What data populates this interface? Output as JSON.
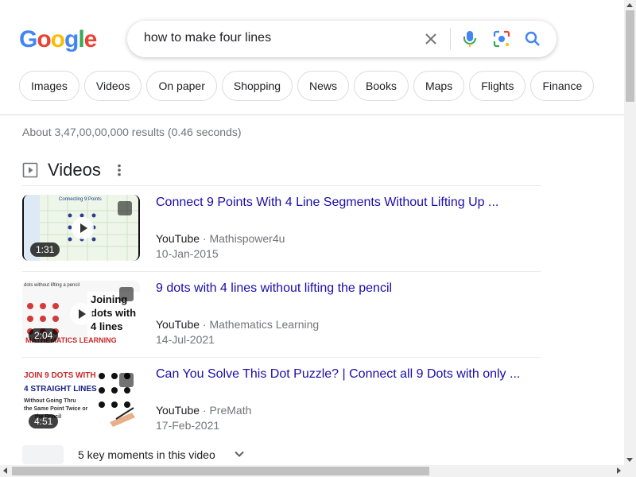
{
  "logo": {
    "letters": [
      "G",
      "o",
      "o",
      "g",
      "l",
      "e"
    ],
    "colors": [
      "#4285F4",
      "#EA4335",
      "#FBBC05",
      "#4285F4",
      "#34A853",
      "#EA4335"
    ]
  },
  "search": {
    "query": "how to make four lines"
  },
  "chips": [
    "Images",
    "Videos",
    "On paper",
    "Shopping",
    "News",
    "Books",
    "Maps",
    "Flights",
    "Finance"
  ],
  "results_stats": "About 3,47,00,00,000 results (0.46 seconds)",
  "videos": {
    "heading": "Videos",
    "items": [
      {
        "title": "Connect 9 Points With 4 Line Segments Without Lifting Up ...",
        "source": "YouTube",
        "channel": "Mathispower4u",
        "date": "10-Jan-2015",
        "duration": "1:31"
      },
      {
        "title": "9 dots with 4 lines without lifting the pencil",
        "source": "YouTube",
        "channel": "Mathematics Learning",
        "date": "14-Jul-2021",
        "duration": "2:04"
      },
      {
        "title": "Can You Solve This Dot Puzzle? | Connect all 9 Dots with only ...",
        "source": "YouTube",
        "channel": "PreMath",
        "date": "17-Feb-2021",
        "duration": "4:51"
      }
    ],
    "thumb_text": {
      "t2": [
        "Joining",
        "dots with",
        "4 lines",
        "MATHEMATICS LEARNING",
        "dots without lifting a pencil"
      ],
      "t3": [
        "JOIN 9 DOTS WITH",
        "4 STRAIGHT LINES",
        "Without Going Thru",
        "the Same Point Twice or",
        "the Pencil"
      ],
      "t1": [
        "Connecting 9 Points"
      ]
    }
  },
  "key_moments": "5 key moments in this video",
  "separator": " · "
}
